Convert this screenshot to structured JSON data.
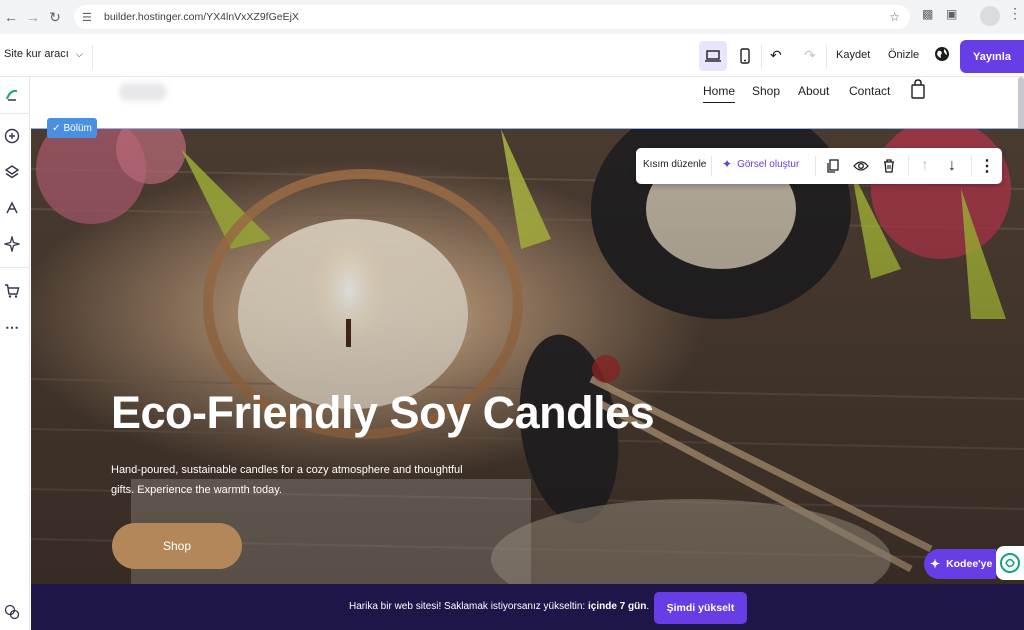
{
  "browser": {
    "url": "builder.hostinger.com/YX4lnVxXZ9fGeEjX"
  },
  "toolbar": {
    "site_tool_label": "Site kur aracı",
    "save_label": "Kaydet",
    "preview_label": "Önizle",
    "publish_label": "Yayınla"
  },
  "site": {
    "nav": [
      "Home",
      "Shop",
      "About",
      "Contact"
    ],
    "hero": {
      "title": "Eco-Friendly Soy Candles",
      "subtitle": "Hand-poured, sustainable candles for a cozy atmosphere and thoughtful gifts. Experience the warmth today.",
      "button_label": "Shop"
    }
  },
  "section": {
    "badge_label": "Bölüm",
    "edit_label": "Kısım düzenle",
    "create_image_label": "Görsel oluştur"
  },
  "banner": {
    "text_prefix": "Harika bir web sitesi! Saklamak istiyorsanız yükseltin:",
    "text_bold": "içinde 7 gün",
    "text_suffix": ".",
    "button_label": "Şimdi yükselt"
  },
  "kodee": {
    "label": "Kodee'ye"
  },
  "colors": {
    "accent": "#673de6",
    "banner_bg": "#1e1649",
    "hero_button": "#b3875a",
    "selection_badge": "#4a90e2"
  },
  "icons": {
    "back": "arrow-left-icon",
    "forward": "arrow-right-icon",
    "reload": "reload-icon",
    "bookmark": "star-icon",
    "desktop": "desktop-icon",
    "mobile": "mobile-icon",
    "undo": "undo-icon",
    "redo": "redo-icon",
    "globe": "globe-icon",
    "cart": "shopping-bag-icon"
  }
}
